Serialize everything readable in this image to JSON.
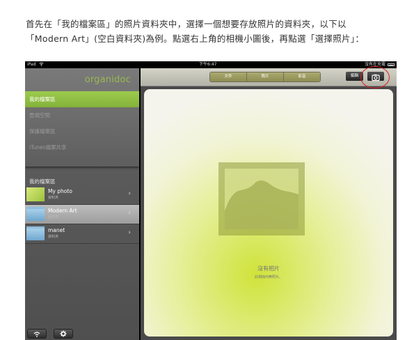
{
  "instructions": {
    "line1": "首先在「我的檔案區」的照片資料夾中，選擇一個想要存放照片的資料夾，以下以",
    "line2": "「Modern Art」(空白資料夾)為例。點選右上角的相機小圖後，再點選「選擇照片」："
  },
  "statusbar": {
    "device": "iPad",
    "wifi_icon": "wifi-icon",
    "time": "下午6:47",
    "battery_text": "沒有在充電"
  },
  "sidebar": {
    "logo": "organidoc",
    "nav": [
      {
        "label": "我的檔案區",
        "active": true
      },
      {
        "label": "雲端空間",
        "active": false
      },
      {
        "label": "保護檔案區",
        "active": false
      },
      {
        "label": "iTunes檔案共享",
        "active": false
      }
    ],
    "folder_header": "我的檔案區",
    "folders": [
      {
        "name": "My photo",
        "sub": "資料夾",
        "thumb": "green"
      },
      {
        "name": "Modern Art",
        "sub": "資料夾",
        "thumb": "folder"
      },
      {
        "name": "manet",
        "sub": "資料夾",
        "thumb": "folder"
      }
    ],
    "bottom_icons": [
      "wifi-icon",
      "gear-icon"
    ]
  },
  "toolbar": {
    "segments": [
      "文件",
      "照片",
      "影音"
    ],
    "edit_label": "編輯",
    "camera_icon": "camera-icon"
  },
  "content": {
    "empty_title": "沒有相片",
    "empty_sub": "此相冊內無照片。"
  },
  "colors": {
    "accent": "#8cc040",
    "highlight_circle": "#e21b1b"
  }
}
